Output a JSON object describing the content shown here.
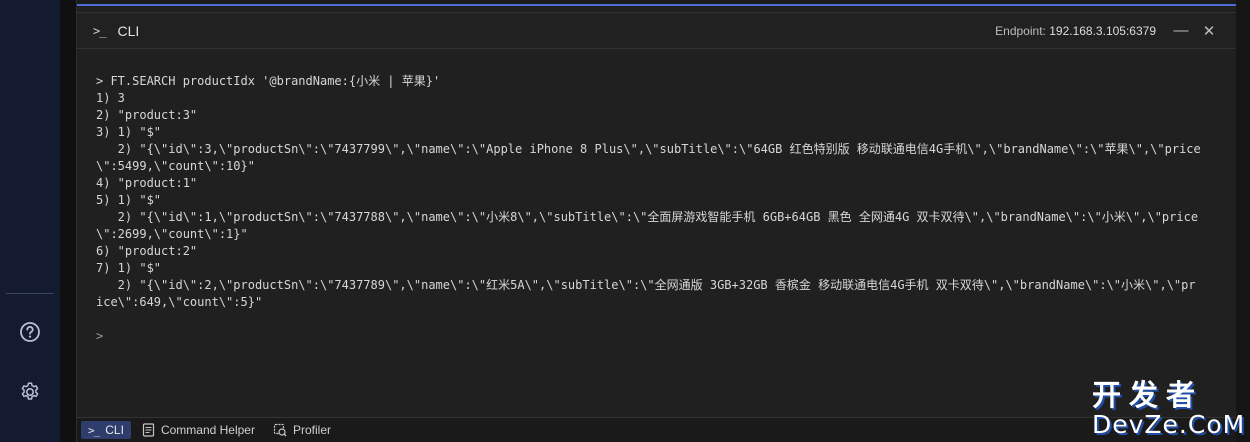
{
  "nav": {
    "help_icon": "question-circle-icon",
    "settings_icon": "gear-icon"
  },
  "header": {
    "prompt_glyph": ">_",
    "title": "CLI",
    "endpoint_label": "Endpoint:",
    "endpoint_value": "192.168.3.105:6379",
    "minimize_glyph": "—",
    "close_glyph": "✕"
  },
  "output": {
    "command": "> FT.SEARCH productIdx '@brandName:{小米 | 苹果}'",
    "lines": [
      "1) 3",
      "2) \"product:3\"",
      "3) 1) \"$\"",
      "   2) \"{\\\"id\\\":3,\\\"productSn\\\":\\\"7437799\\\",\\\"name\\\":\\\"Apple iPhone 8 Plus\\\",\\\"subTitle\\\":\\\"64GB 红色特别版 移动联通电信4G手机\\\",\\\"brandName\\\":\\\"苹果\\\",\\\"price",
      "\\\":5499,\\\"count\\\":10}\"",
      "4) \"product:1\"",
      "5) 1) \"$\"",
      "   2) \"{\\\"id\\\":1,\\\"productSn\\\":\\\"7437788\\\",\\\"name\\\":\\\"小米8\\\",\\\"subTitle\\\":\\\"全面屏游戏智能手机 6GB+64GB 黑色 全网通4G 双卡双待\\\",\\\"brandName\\\":\\\"小米\\\",\\\"price",
      "\\\":2699,\\\"count\\\":1}\"",
      "6) \"product:2\"",
      "7) 1) \"$\"",
      "   2) \"{\\\"id\\\":2,\\\"productSn\\\":\\\"7437789\\\",\\\"name\\\":\\\"红米5A\\\",\\\"subTitle\\\":\\\"全网通版 3GB+32GB 香槟金 移动联通电信4G手机 双卡双待\\\",\\\"brandName\\\":\\\"小米\\\",\\\"pr",
      "ice\\\":649,\\\"count\\\":5}\""
    ],
    "input_prompt": ">"
  },
  "bottom": {
    "tabs": [
      {
        "label": "CLI",
        "icon": "terminal-icon",
        "glyph": ">_"
      },
      {
        "label": "Command Helper",
        "icon": "document-icon"
      },
      {
        "label": "Profiler",
        "icon": "profiler-icon"
      }
    ]
  },
  "watermark": {
    "cn": "开发者",
    "en": "DevZe.CoM"
  }
}
